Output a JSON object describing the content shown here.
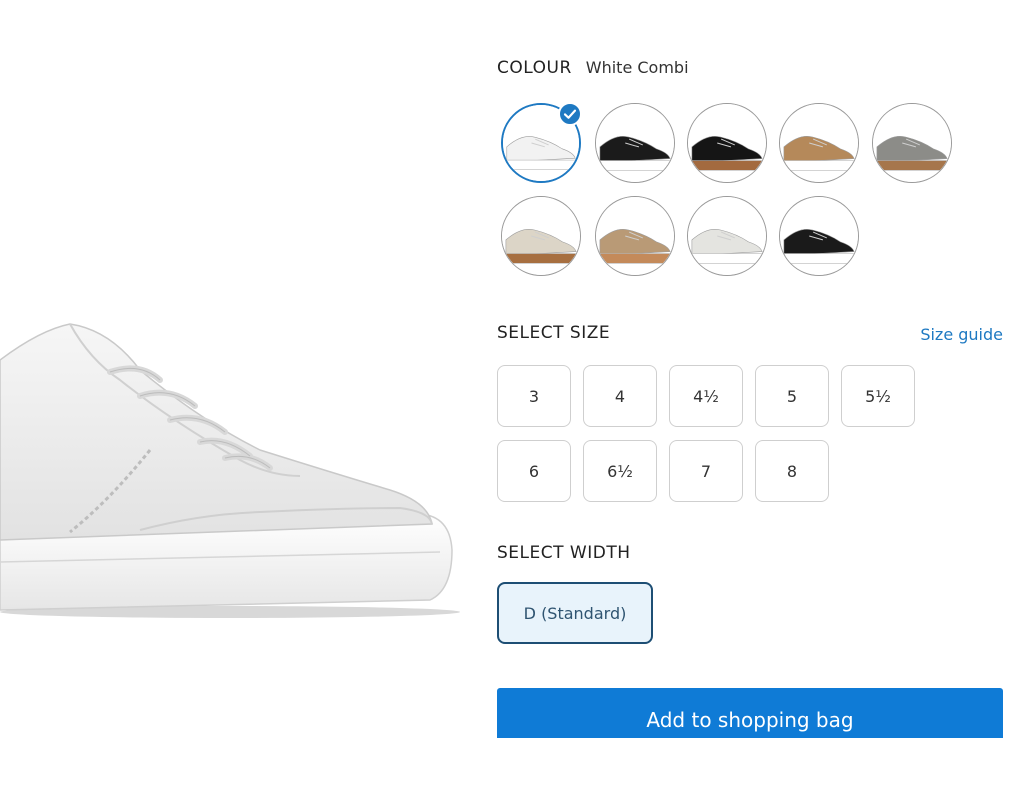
{
  "colour": {
    "label": "COLOUR",
    "value": "White Combi",
    "accent": "#1e79c2",
    "swatches": [
      {
        "name": "white",
        "upper": "#f2f2f2",
        "sole": "#ffffff",
        "selected": true
      },
      {
        "name": "black-white-sole",
        "upper": "#1b1b1b",
        "sole": "#ffffff",
        "selected": false
      },
      {
        "name": "black-gum-sole",
        "upper": "#151515",
        "sole": "#a36a3f",
        "selected": false
      },
      {
        "name": "leopard",
        "upper": "#b5895a",
        "sole": "#ffffff",
        "selected": false
      },
      {
        "name": "grey-gum-sole",
        "upper": "#8c8c88",
        "sole": "#a6764c",
        "selected": false
      },
      {
        "name": "beige-gum-sole",
        "upper": "#dcd5c7",
        "sole": "#a76f40",
        "selected": false
      },
      {
        "name": "metallic-bronze",
        "upper": "#b99a76",
        "sole": "#c48a5a",
        "selected": false
      },
      {
        "name": "off-white",
        "upper": "#e4e4e0",
        "sole": "#ffffff",
        "selected": false
      },
      {
        "name": "black",
        "upper": "#1a1a1a",
        "sole": "#ffffff",
        "selected": false
      }
    ]
  },
  "size": {
    "label": "SELECT SIZE",
    "guide_label": "Size guide",
    "options": [
      "3",
      "4",
      "4½",
      "5",
      "5½",
      "6",
      "6½",
      "7",
      "8"
    ]
  },
  "width": {
    "label": "SELECT WIDTH",
    "options": [
      "D (Standard)"
    ],
    "selected": "D (Standard)"
  },
  "cta": {
    "add_label": "Add to shopping bag",
    "color": "#0f7bd6"
  }
}
